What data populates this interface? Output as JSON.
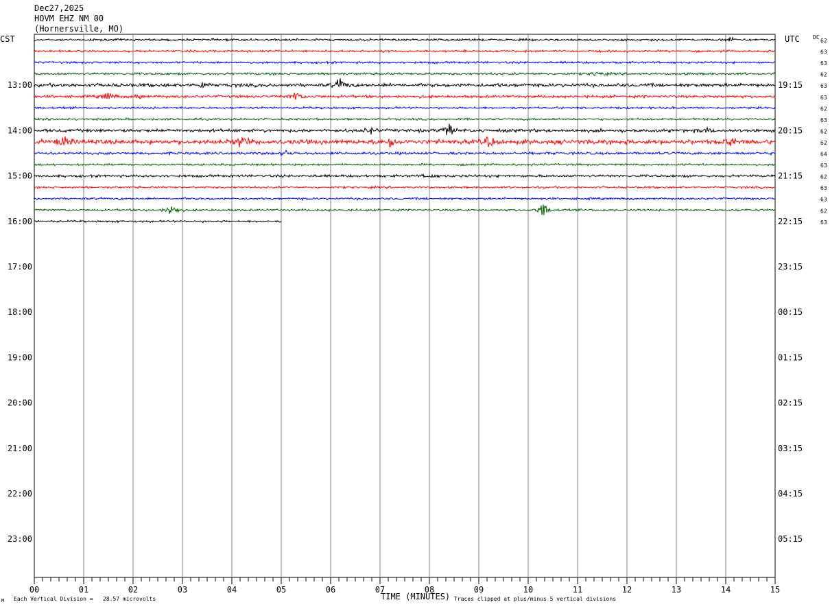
{
  "header": {
    "date": "Dec27,2025",
    "station": "HOVM EHZ NM 00",
    "location": "(Hornersville, MO)"
  },
  "labels": {
    "left_tz": "CST",
    "right_tz": "UTC",
    "dc": "DC",
    "xlabel": "TIME (MINUTES)",
    "scale_note": "Each Vertical Division =   28.57 microvolts",
    "clip_note": "Traces clipped at plus/minus 5 vertical divisions",
    "corner_mark": "M"
  },
  "colors": {
    "trace_cycle": [
      "#000000",
      "#ff0000",
      "#0000ff",
      "#006400"
    ],
    "grid": "#808080",
    "axis": "#000000"
  },
  "chart_data": {
    "type": "line",
    "title": "HOVM EHZ NM 00 (Hornersville, MO) Dec27,2025",
    "xlabel": "TIME (MINUTES)",
    "xlim": [
      0,
      15
    ],
    "x_ticks": [
      "00",
      "01",
      "02",
      "03",
      "04",
      "05",
      "06",
      "07",
      "08",
      "09",
      "10",
      "11",
      "12",
      "13",
      "14",
      "15"
    ],
    "hour_labels_cst": [
      "13:00",
      "14:00",
      "15:00",
      "16:00",
      "17:00",
      "18:00",
      "19:00",
      "20:00",
      "21:00",
      "22:00",
      "23:00"
    ],
    "hour_labels_utc": [
      "19:15",
      "20:15",
      "21:15",
      "22:15",
      "23:15",
      "00:15",
      "01:15",
      "02:15",
      "03:15",
      "04:15",
      "05:15"
    ],
    "grid": true,
    "traces": [
      {
        "start": "12:00",
        "dc": "62",
        "noise": 1.0,
        "bursts": [
          {
            "min": 14.1,
            "amp": 2.5
          }
        ]
      },
      {
        "start": "12:15",
        "dc": "63",
        "noise": 1.0,
        "bursts": []
      },
      {
        "start": "12:30",
        "dc": "63",
        "noise": 1.0,
        "bursts": []
      },
      {
        "start": "12:45",
        "dc": "62",
        "noise": 1.1,
        "bursts": [
          {
            "min": 11.4,
            "amp": 3.5
          }
        ]
      },
      {
        "start": "13:00",
        "dc": "63",
        "noise": 1.6,
        "bursts": [
          {
            "min": 6.2,
            "amp": 7
          },
          {
            "min": 3.4,
            "amp": 3
          }
        ]
      },
      {
        "start": "13:15",
        "dc": "63",
        "noise": 1.3,
        "bursts": [
          {
            "min": 1.5,
            "amp": 5
          },
          {
            "min": 5.3,
            "amp": 6
          },
          {
            "min": 2.1,
            "amp": 2.5
          }
        ]
      },
      {
        "start": "13:30",
        "dc": "62",
        "noise": 1.0,
        "bursts": []
      },
      {
        "start": "13:45",
        "dc": "63",
        "noise": 1.0,
        "bursts": []
      },
      {
        "start": "14:00",
        "dc": "62",
        "noise": 1.5,
        "bursts": [
          {
            "min": 8.4,
            "amp": 9
          },
          {
            "min": 6.8,
            "amp": 3
          },
          {
            "min": 13.6,
            "amp": 3
          }
        ]
      },
      {
        "start": "14:15",
        "dc": "62",
        "noise": 2.2,
        "bursts": [
          {
            "min": 0.6,
            "amp": 6
          },
          {
            "min": 4.2,
            "amp": 7
          },
          {
            "min": 7.2,
            "amp": 7
          },
          {
            "min": 9.2,
            "amp": 5
          },
          {
            "min": 14.1,
            "amp": 5
          }
        ]
      },
      {
        "start": "14:30",
        "dc": "64",
        "noise": 1.2,
        "bursts": [
          {
            "min": 5.1,
            "amp": 3
          }
        ]
      },
      {
        "start": "14:45",
        "dc": "63",
        "noise": 1.0,
        "bursts": []
      },
      {
        "start": "15:00",
        "dc": "62",
        "noise": 1.2,
        "bursts": [
          {
            "min": 8.0,
            "amp": 2.5
          }
        ]
      },
      {
        "start": "15:15",
        "dc": "63",
        "noise": 1.0,
        "bursts": []
      },
      {
        "start": "15:30",
        "dc": "63",
        "noise": 1.0,
        "bursts": []
      },
      {
        "start": "15:45",
        "dc": "62",
        "noise": 1.0,
        "bursts": [
          {
            "min": 2.8,
            "amp": 10
          },
          {
            "min": 10.3,
            "amp": 9
          }
        ]
      },
      {
        "start": "16:00",
        "dc": "63",
        "noise": 1.0,
        "bursts": [],
        "end_min": 5.0
      }
    ]
  }
}
